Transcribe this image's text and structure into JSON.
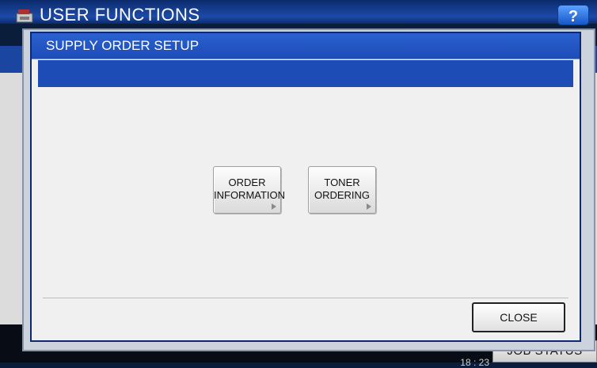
{
  "header": {
    "title": "USER FUNCTIONS",
    "help_label": "?"
  },
  "dialog": {
    "title": "SUPPLY ORDER SETUP",
    "buttons": [
      {
        "line1": "ORDER",
        "line2": "INFORMATION"
      },
      {
        "line1": "TONER",
        "line2": "ORDERING"
      }
    ],
    "close_label": "CLOSE"
  },
  "footer": {
    "time": "18 : 23",
    "job_status_label": "JOB STATUS"
  },
  "colors": {
    "accent": "#1d4cb7",
    "dark_navy": "#0d2a6f"
  },
  "icons": [
    "machine-logo-icon",
    "help-icon",
    "arrow-right-icon"
  ]
}
